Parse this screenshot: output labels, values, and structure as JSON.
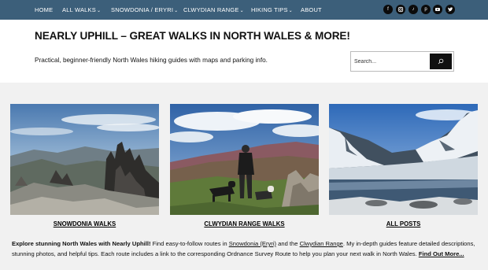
{
  "nav": {
    "items": [
      {
        "label": "HOME",
        "dropdown": false
      },
      {
        "label": "ALL WALKS",
        "dropdown": true
      },
      {
        "label": "SNOWDONIA / ERYRI",
        "dropdown": true
      },
      {
        "label": "CLWYDIAN RANGE",
        "dropdown": true
      },
      {
        "label": "HIKING TIPS",
        "dropdown": true
      },
      {
        "label": "ABOUT",
        "dropdown": false
      }
    ],
    "caret": "⌄",
    "social_icons": [
      "facebook-icon",
      "instagram-icon",
      "tiktok-icon",
      "pinterest-icon",
      "youtube-icon",
      "twitter-icon"
    ]
  },
  "header": {
    "title": "NEARLY UPHILL – GREAT WALKS IN NORTH WALES & MORE!",
    "tagline": "Practical, beginner-friendly North Wales hiking guides with maps and parking info.",
    "search_placeholder": "Search..."
  },
  "cards": [
    {
      "label": "SNOWDONIA WALKS",
      "image": "rocky-peaks-landscape"
    },
    {
      "label": "CLWYDIAN RANGE WALKS",
      "image": "hiker-with-dogs-on-hill"
    },
    {
      "label": "ALL POSTS",
      "image": "snowy-mountain-lake"
    }
  ],
  "intro": {
    "lead": "Explore stunning North Wales with Nearly Uphill!",
    "text1": " Find easy-to-follow routes in ",
    "link1": "Snowdonia (Eryri)",
    "text2": " and the ",
    "link2": "Clwydian Range",
    "text3": ". My in-depth guides feature detailed descriptions, stunning photos, and helpful tips. Each route includes a link to the corresponding Ordnance Survey Route to help you plan your next walk in North Wales. ",
    "more": "Find Out More..."
  },
  "colors": {
    "nav_bg": "#3c5f7a",
    "content_bg": "#f1f1f1",
    "search_button": "#111111"
  }
}
